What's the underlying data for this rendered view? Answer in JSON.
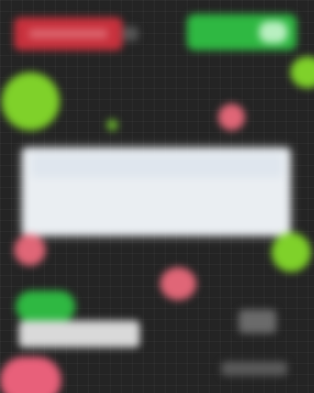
{
  "scene": {
    "background_color": "#242424",
    "colors": {
      "red_pill": "#c8313d",
      "green_button": "#2fb842",
      "lime_orb": "#7fd12a",
      "pink_orb": "#e06677",
      "panel": "#eaeef2",
      "bar_light": "#d9d9d9",
      "bar_dark": "#5a5a5a"
    },
    "blurred": true,
    "legible_text": []
  }
}
